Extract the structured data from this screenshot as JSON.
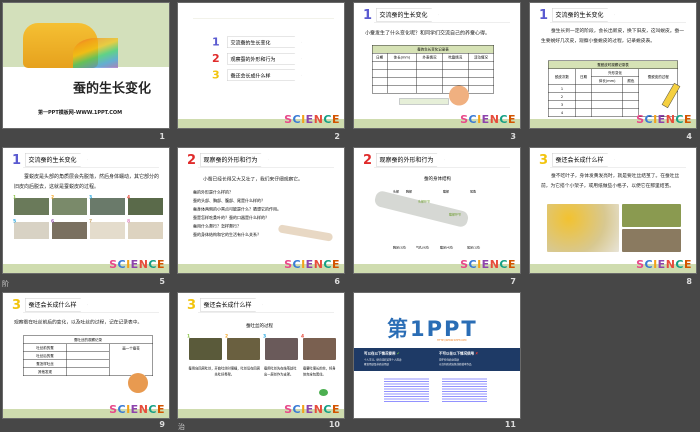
{
  "slides": [
    {
      "number": "1",
      "title": "蚕的生长变化",
      "subtitle": "第一PPT模板网-WWW.1PPT.COM"
    },
    {
      "number": "2",
      "toc": [
        "交流蚕的生长变化",
        "观察蚕的外形和行为",
        "蚕还会长成什么样"
      ],
      "science": "SCIENCE"
    },
    {
      "number": "3",
      "header": "交流蚕的生长变化",
      "text": "小蚕发生了什么变化呢？和同学们交流自己的养蚕心得。",
      "table_title": "蚕的生长变化记录表",
      "columns": [
        "日期",
        "体长(mm)",
        "外表情况",
        "吃桑情况",
        "活动情况"
      ]
    },
    {
      "number": "4",
      "header": "交流蚕的生长变化",
      "text": "蚕生长到一定的阶段，会长出新皮，换下旧皮，这叫蜕皮。蚕一生要蜕好几次皮，观察小蚕蜕皮的过程，记录蜕皮表。",
      "table_title": "蚕蜕皮时观察记录表",
      "columns": [
        "蜕皮次数",
        "日期",
        "外形变化",
        "蚕蜕皮的过程"
      ],
      "subcolumns": [
        "体长(mm)",
        "颜色"
      ],
      "rows": [
        "1",
        "2",
        "3",
        "4"
      ]
    },
    {
      "number": "5",
      "side_label": "阶",
      "header": "交流蚕的生长变化",
      "text": "蚕蜕皮是头部的角质层会先脱落，然后身体蠕动，其它部分的旧皮向后脱去，这就是蚕蜕皮的过程。",
      "steps": [
        "1",
        "2",
        "3",
        "4",
        "5",
        "6",
        "7",
        "8"
      ]
    },
    {
      "number": "6",
      "header": "观察蚕的外形和行为",
      "text": "小蚕已经长得又大又壮了，我们来仔细观察它。",
      "bullets": [
        "蚕的外形是什么样的？",
        "蚕的头部、胸部、腹部、尾是什么样的？",
        "蚕身体两侧的小黑点可能是什么？猜想它的作用。",
        "蚕是怎样吃桑叶的？蚕的口器是什么样的？",
        "蚕用什么爬行？怎样爬行？",
        "蚕的身体结构和它的生活有什么关系？"
      ]
    },
    {
      "number": "7",
      "header": "观察蚕的外形和行为",
      "diagram_title": "蚕的身体结构",
      "labels_top": [
        "头部",
        "胸部",
        "腹部",
        "尾角"
      ],
      "labels_green": [
        "头部环节",
        "腹部环节"
      ],
      "labels_bottom": [
        "胸足(3对)",
        "气孔(9对)",
        "腹足(4对)",
        "尾足(1对)"
      ]
    },
    {
      "number": "8",
      "header": "蚕还会长成什么样",
      "text": "蚕不吃叶子，身体发黄发亮时，就是要吐丝结茧了。在蚕吐丝前，为它搭个小架子，或用纸做些小格子，以便它在那里结茧。"
    },
    {
      "number": "9",
      "header": "蚕还会长成什么样",
      "text": "观察蚕在吐丝前后的变化，以及吐丝的过程，记在记录表中。",
      "table_title": "蚕吐丝的观察记录",
      "rows": [
        "吐丝前的蚕",
        "吐丝后的蚕",
        "蚕怎样吐丝",
        "其他发现"
      ],
      "right_cell": "画一个蚕茧"
    },
    {
      "number": "10",
      "side_label": "治",
      "header": "蚕还会长成什么样",
      "diagram_title": "蚕吐丝的过程",
      "steps": [
        "1",
        "2",
        "3",
        "4"
      ],
      "captions": [
        "蚕用向四周吐丝，开始吐丝时很细，吐丝后在四周先吐好骨架。",
        "蚕用吐丝先在结茧处吐出一层丝作为支架。",
        "蚕要吐很长的丝，将身体完全包裹住。"
      ]
    },
    {
      "number": "11",
      "logo": "第1PPT",
      "url": "HTTP://WWW.1PPT.COM",
      "can_use": "可以在以下情况使用",
      "cannot_use": "不可以在以下情况使用",
      "can_lines": [
        "个人学习、研究或欣赏等个人用途",
        "教育用途及非商业用途"
      ],
      "cannot_lines": [
        "用于任何商业用途",
        "以任何形式出售或转载本作品"
      ]
    }
  ],
  "colors": {
    "background": "#474747",
    "footer_green": "#cfdcaf",
    "banner_blue": "#1e3a66",
    "logo_blue": "#2a6db5",
    "logo_orange": "#f07d1a"
  }
}
